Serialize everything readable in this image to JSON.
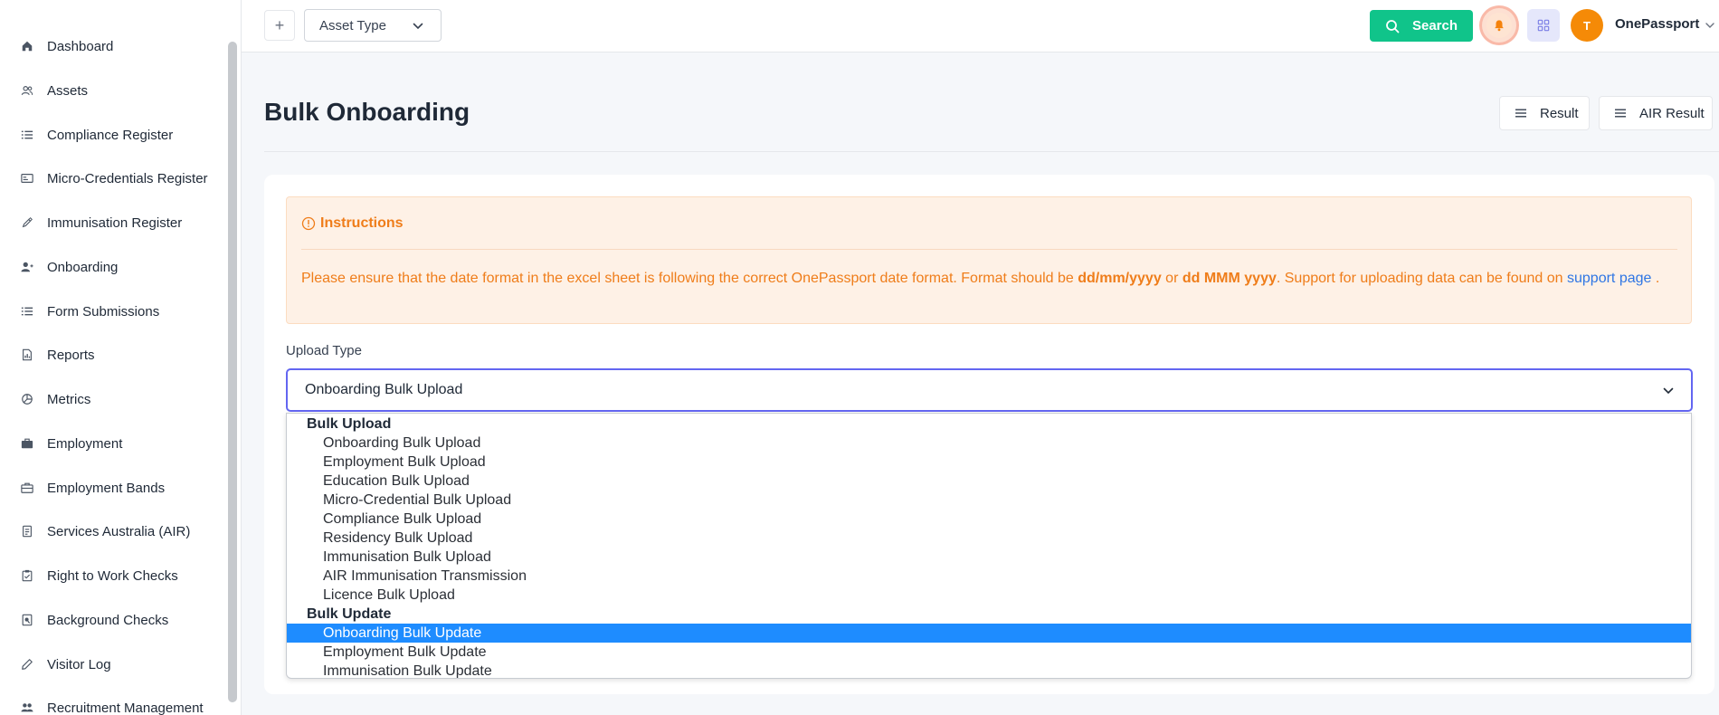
{
  "sidebar": {
    "items": [
      {
        "label": "Dashboard",
        "icon": "home-icon"
      },
      {
        "label": "Assets",
        "icon": "users-icon"
      },
      {
        "label": "Compliance Register",
        "icon": "list-icon"
      },
      {
        "label": "Micro-Credentials Register",
        "icon": "id-card-icon"
      },
      {
        "label": "Immunisation Register",
        "icon": "syringe-icon"
      },
      {
        "label": "Onboarding",
        "icon": "user-plus-icon"
      },
      {
        "label": "Form Submissions",
        "icon": "list-icon"
      },
      {
        "label": "Reports",
        "icon": "file-report-icon"
      },
      {
        "label": "Metrics",
        "icon": "pie-chart-icon"
      },
      {
        "label": "Employment",
        "icon": "briefcase-icon"
      },
      {
        "label": "Employment Bands",
        "icon": "briefcase-outline-icon"
      },
      {
        "label": "Services Australia (AIR)",
        "icon": "document-icon"
      },
      {
        "label": "Right to Work Checks",
        "icon": "clipboard-check-icon"
      },
      {
        "label": "Background Checks",
        "icon": "file-search-icon"
      },
      {
        "label": "Visitor Log",
        "icon": "pencil-icon"
      },
      {
        "label": "Recruitment Management",
        "icon": "users-group-icon"
      }
    ]
  },
  "topbar": {
    "add_label": "+",
    "asset_type": "Asset Type",
    "search_label": "Search",
    "avatar_initial": "T",
    "brand": "OnePassport",
    "accent_green": "#10c48a",
    "avatar_color": "#f58a07"
  },
  "header": {
    "title": "Bulk Onboarding",
    "result_label": "Result",
    "air_result_label": "AIR Result"
  },
  "instructions": {
    "title": "Instructions",
    "text_1": "Please ensure that the date format in the excel sheet is following the correct OnePassport date format. Format should be ",
    "format_1": "dd/mm/yyyy",
    "text_or": " or ",
    "format_2": "dd MMM yyyy",
    "text_2": ". Support for uploading data can be found on ",
    "link": "support page",
    "text_3": " .",
    "color": "#ef7d1a"
  },
  "upload": {
    "label": "Upload Type",
    "selected": "Onboarding Bulk Upload",
    "groups": [
      {
        "label": "Bulk Upload",
        "options": [
          "Onboarding Bulk Upload",
          "Employment Bulk Upload",
          "Education Bulk Upload",
          "Micro-Credential Bulk Upload",
          "Compliance Bulk Upload",
          "Residency Bulk Upload",
          "Immunisation Bulk Upload",
          "AIR Immunisation Transmission",
          "Licence Bulk Upload"
        ]
      },
      {
        "label": "Bulk Update",
        "options": [
          "Onboarding Bulk Update",
          "Employment Bulk Update",
          "Immunisation Bulk Update"
        ]
      }
    ],
    "highlighted": "Onboarding Bulk Update",
    "highlight_color": "#1e8cff"
  }
}
